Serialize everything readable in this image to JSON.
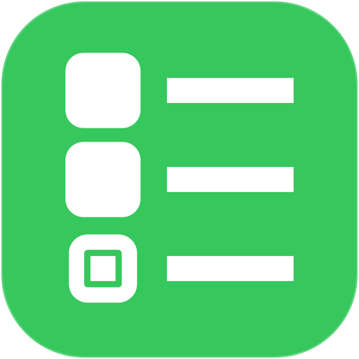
{
  "app_icon": {
    "name": "checklist-app-icon",
    "background_color": "#36c75d",
    "glyph_color": "#ffffff",
    "items": [
      {
        "checkbox": "filled",
        "line": "text-line"
      },
      {
        "checkbox": "filled",
        "line": "text-line"
      },
      {
        "checkbox": "outlined-with-inner-square",
        "line": "text-line"
      }
    ]
  }
}
